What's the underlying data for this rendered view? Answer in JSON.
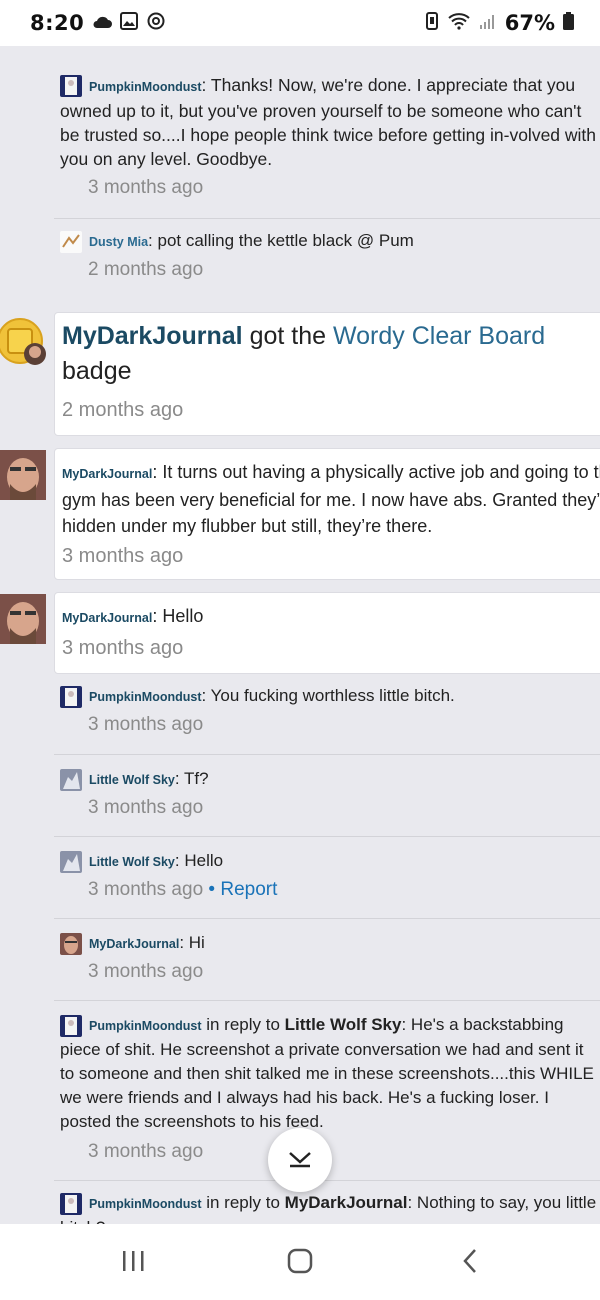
{
  "status_bar": {
    "time": "8:20",
    "battery": "67%"
  },
  "feed": {
    "items": [
      {
        "kind": "reply",
        "author": "PumpkinMoondust",
        "text": ": Thanks! Now, we're done. I appreciate that you owned up to it, but you've proven yourself to be someone who can't be trusted so....I hope people think twice before getting in-volved with you on any level. Goodbye.",
        "time": "3 months ago"
      },
      {
        "kind": "reply",
        "author": "Dusty Mia",
        "text": ": pot calling the kettle black @ Pum",
        "time": "2 months ago"
      },
      {
        "kind": "badge",
        "author": "MyDarkJournal",
        "middle": " got the ",
        "badge_name": "Wordy Clear Board",
        "suffix": " badge",
        "time": "2 months ago"
      },
      {
        "kind": "post",
        "author": "MyDarkJournal",
        "text": ": It turns out having a physically active job and going to the gym has been very beneficial for me. I now have abs. Granted they’re hidden under my flubber but still, they’re there.",
        "time": "3 months ago"
      },
      {
        "kind": "post",
        "author": "MyDarkJournal",
        "text": ": Hello",
        "time": "3 months ago"
      },
      {
        "kind": "reply",
        "author": "PumpkinMoondust",
        "text": ": You fucking worthless little bitch.",
        "time": "3 months ago"
      },
      {
        "kind": "reply",
        "author": "Little Wolf Sky",
        "text": ": Tf?",
        "time": "3 months ago"
      },
      {
        "kind": "reply",
        "author": "Little Wolf Sky",
        "text": ": Hello",
        "time": "3 months ago",
        "separator": " • ",
        "action": "Report"
      },
      {
        "kind": "reply",
        "author": "MyDarkJournal",
        "text": ": Hi",
        "time": "3 months ago"
      },
      {
        "kind": "reply",
        "author": "PumpkinMoondust",
        "reply_word": " in reply to ",
        "target": "Little Wolf Sky",
        "text": ": He's a backstabbing piece of shit. He screenshot a private conversation we had and sent it to someone and then shit talked me in these screenshots....this WHILE we were friends and I always had his back. He's a fucking loser. I posted the screenshots to his feed.",
        "time": "3 months ago"
      },
      {
        "kind": "reply",
        "author": "PumpkinMoondust",
        "reply_word": " in reply to ",
        "target": "MyDarkJournal",
        "text": ": Nothing to say, you little bitch?"
      }
    ]
  },
  "colors": {
    "link": "#1a73b8",
    "username": "#1b4a63",
    "badge_link": "#2a6a90",
    "timestamp": "#8a8a8a",
    "background": "#e9e9ee"
  },
  "icons": [
    "cloud-icon",
    "gallery-icon",
    "sync-icon",
    "vibrate-icon",
    "wifi-icon",
    "signal-icon",
    "battery-icon",
    "scroll-down-chevron-icon",
    "recents-icon",
    "home-icon",
    "back-icon"
  ]
}
